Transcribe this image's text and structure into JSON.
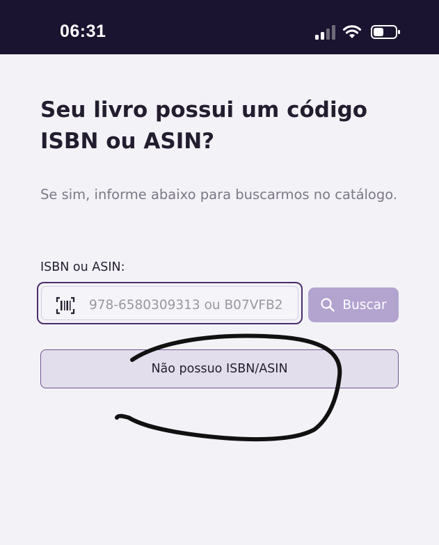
{
  "status_bar": {
    "time": "06:31",
    "icons": [
      "signal-icon",
      "wifi-icon",
      "battery-icon"
    ]
  },
  "page": {
    "title": "Seu livro possui um código ISBN ou ASIN?",
    "subtitle": "Se sim, informe abaixo para buscarmos no catálogo."
  },
  "form": {
    "label": "ISBN ou ASIN:",
    "input_placeholder": "978-6580309313 ou B07VFB2",
    "input_value": "",
    "input_icon": "barcode-scan-icon",
    "search_label": "Buscar",
    "search_icon": "search-icon",
    "no_isbn_label": "Não possuo ISBN/ASIN"
  },
  "colors": {
    "status_bar_bg": "#1b1430",
    "background": "#f3f2f7",
    "primary": "#4a2d6b",
    "search_button_bg": "#b3a3cf",
    "secondary_button_bg": "#e3deec",
    "annotation_ink": "#111111"
  }
}
